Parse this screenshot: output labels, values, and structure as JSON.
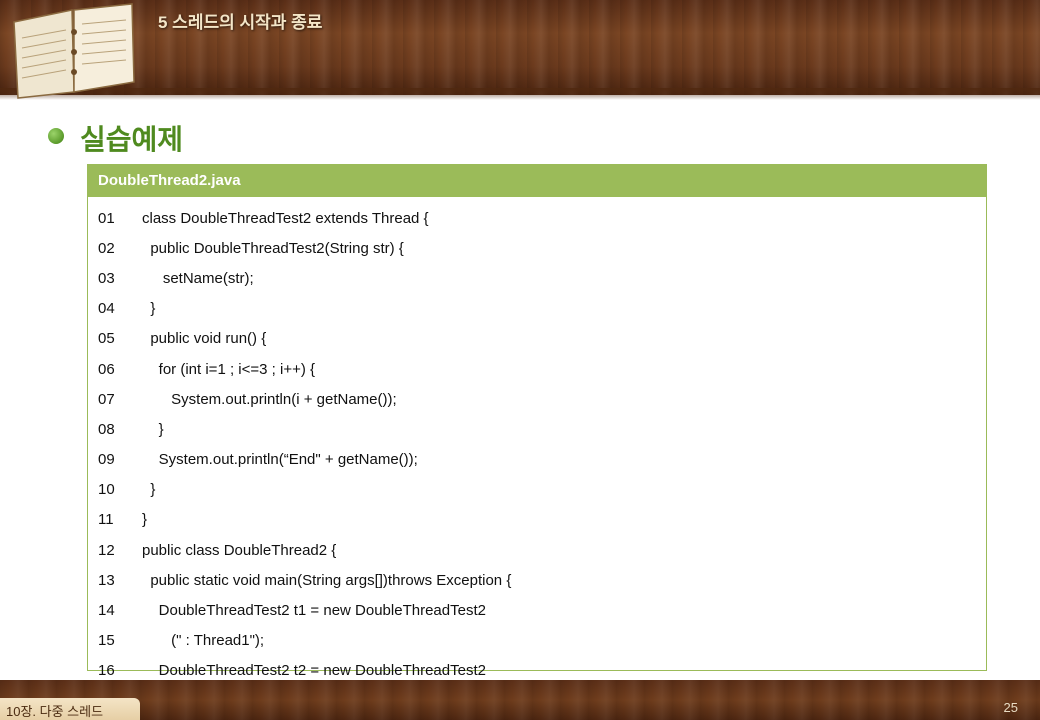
{
  "header": {
    "chapter_title": "5 스레드의 시작과 종료"
  },
  "section": {
    "title": "실습예제"
  },
  "code": {
    "filename": "DoubleThread2.java",
    "lines": [
      {
        "no": "01",
        "text": "class DoubleThreadTest2 extends Thread {"
      },
      {
        "no": "02",
        "text": "  public DoubleThreadTest2(String str) {"
      },
      {
        "no": "03",
        "text": "     setName(str);"
      },
      {
        "no": "04",
        "text": "  }"
      },
      {
        "no": "05",
        "text": "  public void run() {"
      },
      {
        "no": "06",
        "text": "    for (int i=1 ; i<=3 ; i++) {"
      },
      {
        "no": "07",
        "text": "       System.out.println(i + getName());"
      },
      {
        "no": "08",
        "text": "    }"
      },
      {
        "no": "09",
        "text": "    System.out.println(“End\" + getName());"
      },
      {
        "no": "10",
        "text": "  }"
      },
      {
        "no": "11",
        "text": "}"
      },
      {
        "no": "12",
        "text": "public class DoubleThread2 {"
      },
      {
        "no": "13",
        "text": "  public static void main(String args[])throws Exception {"
      },
      {
        "no": "14",
        "text": "    DoubleThreadTest2 t1 = new DoubleThreadTest2"
      },
      {
        "no": "15",
        "text": "       (\" : Thread1\");"
      },
      {
        "no": "16",
        "text": "    DoubleThreadTest2 t2 = new DoubleThreadTest2"
      }
    ]
  },
  "footer": {
    "chapter_label": "10장. 다중 스레드",
    "page_number": "25"
  }
}
